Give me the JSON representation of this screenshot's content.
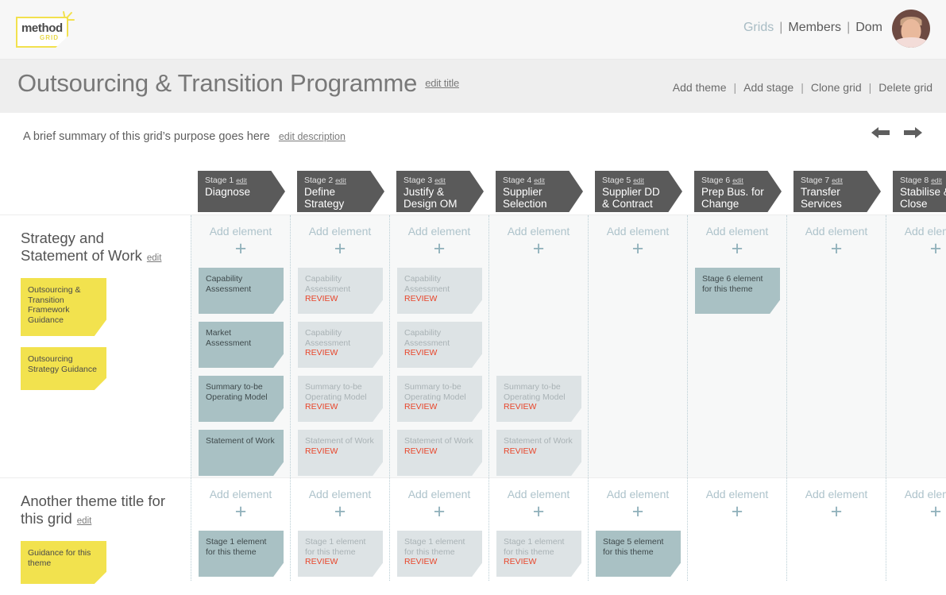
{
  "brand": {
    "logo_word": "method",
    "logo_sub": "GRID",
    "logo_color": "#f2e14e"
  },
  "topnav": {
    "items": [
      {
        "label": "Grids",
        "muted": true
      },
      {
        "label": "Members",
        "muted": false
      },
      {
        "label": "Dom",
        "muted": false
      }
    ],
    "separator": "|",
    "avatar_name": "user-avatar"
  },
  "header": {
    "title": "Outsourcing & Transition Programme",
    "edit_title_label": "edit title",
    "actions": [
      "Add theme",
      "Add stage",
      "Clone grid",
      "Delete grid"
    ],
    "action_separator": "|"
  },
  "description": {
    "text": "A brief summary of this grid’s purpose goes here",
    "edit_label": "edit description",
    "prev_label": "←",
    "next_label": "→"
  },
  "stages": [
    {
      "num": "Stage 1",
      "edit": "edit",
      "name": "Diagnose"
    },
    {
      "num": "Stage 2",
      "edit": "edit",
      "name": "Define\nStrategy"
    },
    {
      "num": "Stage 3",
      "edit": "edit",
      "name": "Justify &\nDesign OM"
    },
    {
      "num": "Stage 4",
      "edit": "edit",
      "name": "Supplier\nSelection"
    },
    {
      "num": "Stage 5",
      "edit": "edit",
      "name": "Supplier DD\n& Contract"
    },
    {
      "num": "Stage 6",
      "edit": "edit",
      "name": "Prep Bus. for\nChange"
    },
    {
      "num": "Stage 7",
      "edit": "edit",
      "name": "Transfer\nServices"
    },
    {
      "num": "Stage 8",
      "edit": "edit",
      "name": "Stabilise &\nClose"
    }
  ],
  "add_element_label": "Add element",
  "add_element_plus": "+",
  "review_label": "REVIEW",
  "colors": {
    "stage_chip": "#5a5a5a",
    "card_active": "#a9c1c4",
    "card_review": "#dde3e5",
    "sticky": "#f2e24e",
    "review_text": "#e8452a",
    "add_element": "#aec3cb"
  },
  "themes": [
    {
      "title": "Strategy and Statement of Work",
      "edit_label": "edit",
      "stickies": [
        "Outsourcing & Transition Framework Guidance",
        "Outsourcing Strategy Guidance"
      ],
      "columns": [
        {
          "cards": [
            {
              "text": "Capability Assessment",
              "state": "active"
            },
            {
              "text": "Market Assessment",
              "state": "active"
            },
            {
              "text": "Summary to-be Operating Model",
              "state": "active"
            },
            {
              "text": "Statement of Work",
              "state": "active"
            }
          ]
        },
        {
          "cards": [
            {
              "text": "Capability Assessment",
              "state": "review"
            },
            {
              "text": "Capability Assessment",
              "state": "review"
            },
            {
              "text": "Summary to-be Operating Model",
              "state": "review"
            },
            {
              "text": "Statement of Work",
              "state": "review"
            }
          ]
        },
        {
          "cards": [
            {
              "text": "Capability Assessment",
              "state": "review"
            },
            {
              "text": "Capability Assessment",
              "state": "review"
            },
            {
              "text": "Summary to-be Operating Model",
              "state": "review"
            },
            {
              "text": "Statement of Work",
              "state": "review"
            }
          ]
        },
        {
          "cards": [
            {
              "text": "",
              "state": "empty"
            },
            {
              "text": "",
              "state": "empty"
            },
            {
              "text": "Summary to-be Operating Model",
              "state": "review"
            },
            {
              "text": "Statement of Work",
              "state": "review"
            }
          ]
        },
        {
          "cards": []
        },
        {
          "cards": [
            {
              "text": "Stage 6 element for this theme",
              "state": "active"
            }
          ]
        },
        {
          "cards": []
        },
        {
          "cards": []
        }
      ]
    },
    {
      "title": "Another theme title for this grid",
      "edit_label": "edit",
      "stickies": [
        "Guidance for this theme"
      ],
      "columns": [
        {
          "cards": [
            {
              "text": "Stage 1 element for this theme",
              "state": "active"
            }
          ]
        },
        {
          "cards": [
            {
              "text": "Stage 1 element for this theme",
              "state": "review"
            }
          ]
        },
        {
          "cards": [
            {
              "text": "Stage 1 element for this theme",
              "state": "review"
            }
          ]
        },
        {
          "cards": [
            {
              "text": "Stage 1 element for this theme",
              "state": "review"
            }
          ]
        },
        {
          "cards": [
            {
              "text": "Stage 5 element for this theme",
              "state": "active"
            }
          ]
        },
        {
          "cards": []
        },
        {
          "cards": []
        },
        {
          "cards": []
        }
      ]
    }
  ]
}
